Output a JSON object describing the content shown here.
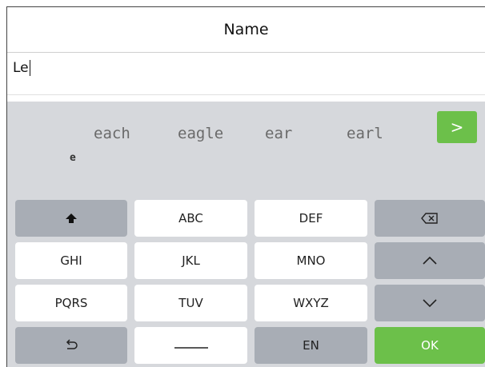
{
  "header": {
    "title": "Name"
  },
  "input": {
    "value": "Le"
  },
  "candidates": {
    "words": [
      "each",
      "eagle",
      "ear",
      "earl"
    ],
    "composition": "e",
    "next_label": ">"
  },
  "keys": {
    "row1": [
      "",
      "ABC",
      "DEF",
      ""
    ],
    "row2": [
      "GHI",
      "JKL",
      "MNO",
      ""
    ],
    "row3": [
      "PQRS",
      "TUV",
      "WXYZ",
      ""
    ],
    "row4": [
      "",
      "",
      "EN",
      "OK"
    ]
  },
  "icons": {
    "shift": "shift-arrow-up",
    "backspace": "backspace-x",
    "cursor_up": "chevron-up",
    "cursor_down": "chevron-down",
    "back": "undo-arrow",
    "space": "space-bar"
  },
  "colors": {
    "accent": "#6cc04a",
    "gray_key": "#a8adb5",
    "keyboard_bg": "#d6d8dc"
  }
}
